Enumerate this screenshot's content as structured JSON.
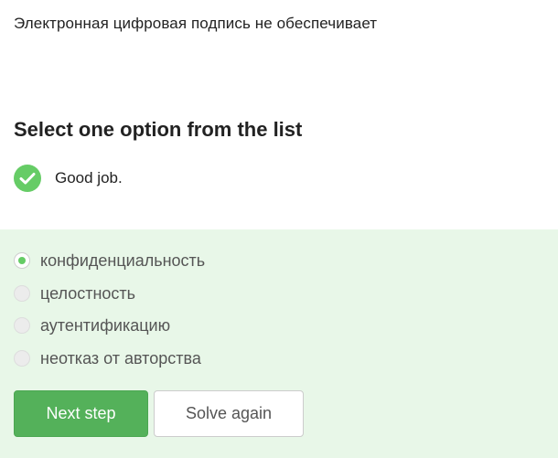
{
  "question": {
    "text": "Электронная цифровая подпись не обеспечивает"
  },
  "prompt": {
    "text": "Select one option from the list"
  },
  "feedback": {
    "icon": "check-circle-icon",
    "text": "Good job.",
    "color": "#66cc66"
  },
  "options": [
    {
      "label": "конфиденциальность",
      "selected": true
    },
    {
      "label": "целостность",
      "selected": false
    },
    {
      "label": "аутентификацию",
      "selected": false
    },
    {
      "label": "неотказ от авторства",
      "selected": false
    }
  ],
  "buttons": {
    "next_label": "Next step",
    "solve_again_label": "Solve again"
  },
  "colors": {
    "accent": "#54b15a",
    "panel_background": "#e8f7e8"
  }
}
